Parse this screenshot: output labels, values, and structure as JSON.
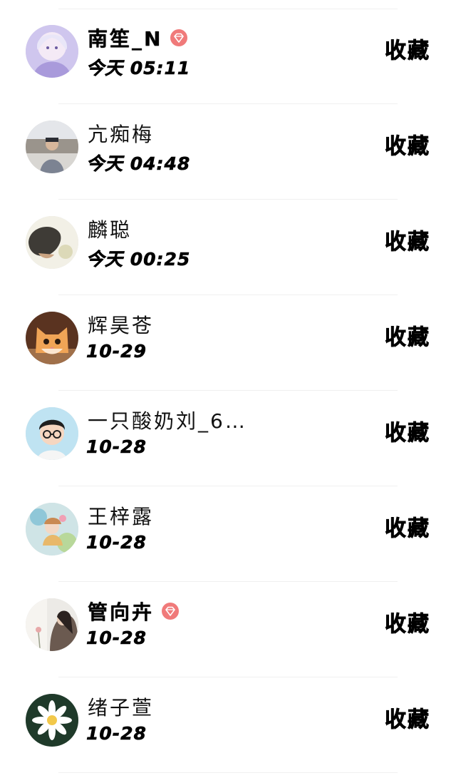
{
  "rows": [
    {
      "name": "南笙_N",
      "time": "今天 05:11",
      "action": "收藏",
      "vip": true,
      "name_style": "bold"
    },
    {
      "name": "亢痴梅",
      "time": "今天 04:48",
      "action": "收藏",
      "vip": false,
      "name_style": "normal"
    },
    {
      "name": "麟聪",
      "time": "今天 00:25",
      "action": "收藏",
      "vip": false,
      "name_style": "normal"
    },
    {
      "name": "辉昊苍",
      "time": "10-29",
      "action": "收藏",
      "vip": false,
      "name_style": "normal"
    },
    {
      "name": "一只酸奶刘_6…",
      "time": "10-28",
      "action": "收藏",
      "vip": false,
      "name_style": "normal"
    },
    {
      "name": "王梓露",
      "time": "10-28",
      "action": "收藏",
      "vip": false,
      "name_style": "normal"
    },
    {
      "name": "管向卉",
      "time": "10-28",
      "action": "收藏",
      "vip": true,
      "name_style": "bold"
    },
    {
      "name": "绪子萱",
      "time": "10-28",
      "action": "收藏",
      "vip": false,
      "name_style": "normal"
    }
  ],
  "colors": {
    "vip_badge": "#f07a7a",
    "divider": "#f0f0f0",
    "text": "#000000"
  },
  "icons": {
    "vip": "diamond-badge-icon",
    "avatar": "avatar-image"
  }
}
